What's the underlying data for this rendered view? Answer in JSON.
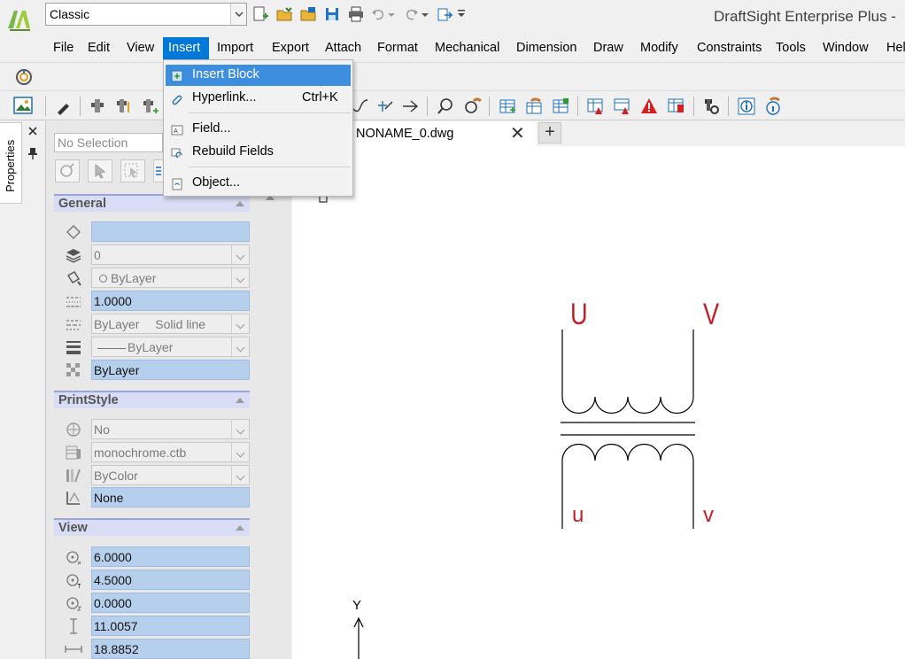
{
  "window": {
    "title": "DraftSight Enterprise Plus -"
  },
  "workspace": {
    "selected": "Classic"
  },
  "menu": [
    {
      "label": "File"
    },
    {
      "label": "Edit"
    },
    {
      "label": "View"
    },
    {
      "label": "Insert"
    },
    {
      "label": "Import"
    },
    {
      "label": "Export"
    },
    {
      "label": "Attach"
    },
    {
      "label": "Format"
    },
    {
      "label": "Mechanical"
    },
    {
      "label": "Dimension"
    },
    {
      "label": "Draw"
    },
    {
      "label": "Modify"
    },
    {
      "label": "Constraints"
    },
    {
      "label": "Tools"
    },
    {
      "label": "Window"
    },
    {
      "label": "Hel"
    }
  ],
  "insert_menu": {
    "items": [
      {
        "label": "Insert Block",
        "shortcut": ""
      },
      {
        "label": "Hyperlink...",
        "shortcut": "Ctrl+K"
      },
      {
        "label": "Field...",
        "shortcut": ""
      },
      {
        "label": "Rebuild Fields",
        "shortcut": ""
      },
      {
        "label": "Object...",
        "shortcut": ""
      }
    ]
  },
  "side_tab": {
    "label": "Properties"
  },
  "properties": {
    "selection": "No Selection",
    "general": {
      "title": "General",
      "color": "",
      "layer": "0",
      "plot_color": "ByLayer",
      "linetype_scale": "1.0000",
      "linetype": "ByLayer",
      "linetype_desc": "Solid line",
      "lineweight": "ByLayer",
      "transparency": "ByLayer"
    },
    "printstyle": {
      "title": "PrintStyle",
      "print_style": "No",
      "print_table": "monochrome.ctb",
      "print_color": "ByColor",
      "print_none": "None"
    },
    "view": {
      "title": "View",
      "center_x": "6.0000",
      "center_y": "4.5000",
      "center_z": "0.0000",
      "height": "11.0057",
      "width": "18.8852"
    }
  },
  "document": {
    "tab": "NONAME_0.dwg"
  },
  "drawing": {
    "top_left_label": "U",
    "top_right_label": "V",
    "bottom_left_label": "u",
    "bottom_right_label": "v",
    "ucs_y_label": "Y",
    "label_color": "#c0202a",
    "line_color": "#000000"
  },
  "colors": {
    "menu_active": "#0078d7",
    "menu_highlight": "#3d8ede",
    "field_blue": "#b6cfec",
    "section_header": "#d8dcf4"
  }
}
